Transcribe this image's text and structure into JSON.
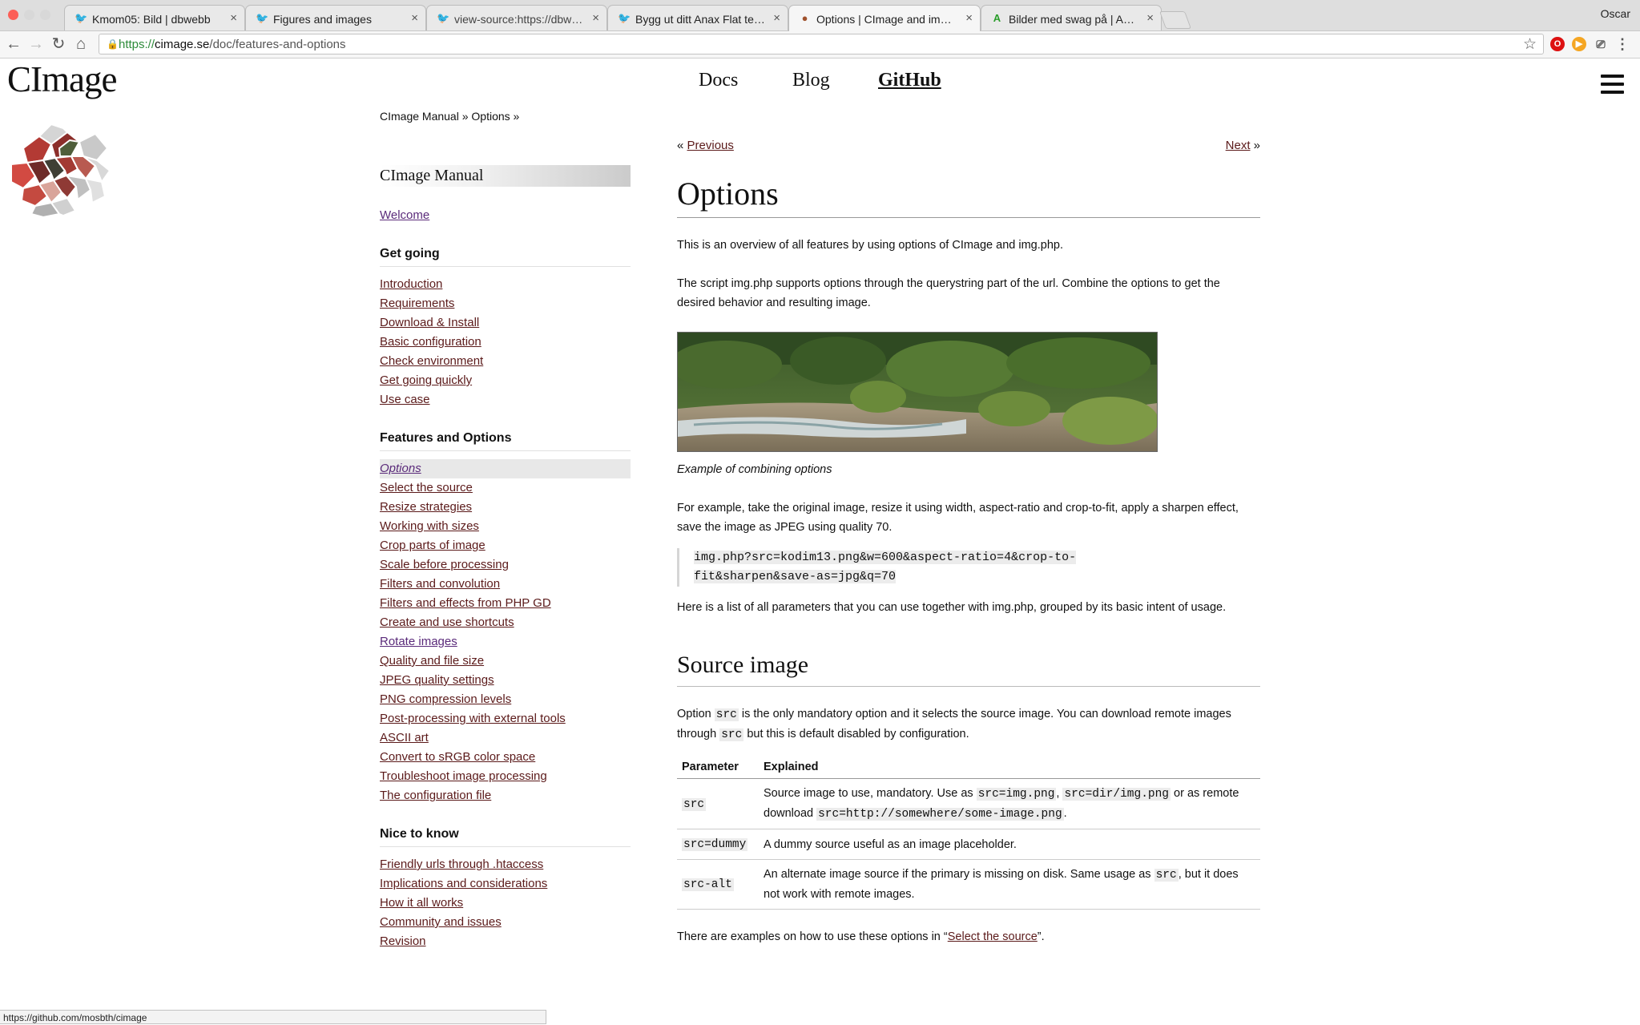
{
  "browser": {
    "tabs": [
      {
        "title": "Kmom05: Bild | dbwebb",
        "active": false
      },
      {
        "title": "Figures and images",
        "active": false
      },
      {
        "title": "view-source:https://dbwebb.se",
        "active": false
      },
      {
        "title": "Bygg ut ditt Anax Flat tema me",
        "active": false
      },
      {
        "title": "Options | CImage and img.php",
        "active": true
      },
      {
        "title": "Bilder med swag på | Anax Flat",
        "active": false
      }
    ],
    "profile_name": "Oscar",
    "url_protocol": "https://",
    "url_host": "cimage.se",
    "url_path": "/doc/features-and-options",
    "status_url": "https://github.com/mosbth/cimage"
  },
  "site": {
    "logo": "CImage",
    "nav": [
      "Docs",
      "Blog",
      "GitHub"
    ]
  },
  "breadcrumb": "CImage Manual » Options »",
  "sidebar": {
    "title": "CImage Manual",
    "welcome": "Welcome",
    "sections": [
      {
        "heading": "Get going",
        "links": [
          "Introduction",
          "Requirements",
          "Download & Install",
          "Basic configuration",
          "Check environment",
          "Get going quickly",
          "Use case"
        ]
      },
      {
        "heading": "Features and Options",
        "links": [
          "Options",
          "Select the source",
          "Resize strategies",
          "Working with sizes",
          "Crop parts of image",
          "Scale before processing",
          "Filters and convolution",
          "Filters and effects from PHP GD",
          "Create and use shortcuts",
          "Rotate images",
          "Quality and file size",
          "JPEG quality settings",
          "PNG compression levels",
          "Post-processing with external tools",
          "ASCII art",
          "Convert to sRGB color space",
          "Troubleshoot image processing",
          "The configuration file"
        ]
      },
      {
        "heading": "Nice to know",
        "links": [
          "Friendly urls through .htaccess",
          "Implications and considerations",
          "How it all works",
          "Community and issues",
          "Revision"
        ]
      }
    ]
  },
  "article": {
    "prev": "Previous",
    "next": "Next",
    "title": "Options",
    "intro": "This is an overview of all features by using options of CImage and img.php.",
    "para2": "The script img.php supports options through the querystring part of the url. Combine the options to get the desired behavior and resulting image.",
    "caption": "Example of combining options",
    "para3": "For example, take the original image, resize it using width, aspect-ratio and crop-to-fit, apply a sharpen effect, save the image as JPEG using quality 70.",
    "code_line1": "img.php?src=kodim13.png&w=600&aspect-ratio=4&crop-to-",
    "code_line2": "fit&sharpen&save-as=jpg&q=70",
    "para4": "Here is a list of all parameters that you can use together with img.php, grouped by its basic intent of usage.",
    "section_title": "Source image",
    "src_p_1": "Option ",
    "src_p_code1": "src",
    "src_p_2": " is the only mandatory option and it selects the source image. You can download remote images through ",
    "src_p_code2": "src",
    "src_p_3": " but this is default disabled by configuration.",
    "table_headers": [
      "Parameter",
      "Explained"
    ],
    "row1_param": "src",
    "row1_t1": "Source image to use, mandatory. Use as ",
    "row1_c1": "src=img.png",
    "row1_t2": ", ",
    "row1_c2": "src=dir/img.png",
    "row1_t3": " or as remote download ",
    "row1_c3": "src=http://somewhere/some-image.png",
    "row1_t4": ".",
    "row2_param": "src=dummy",
    "row2_text": "A dummy source useful as an image placeholder.",
    "row3_param": "src-alt",
    "row3_t1": "An alternate image source if the primary is missing on disk. Same usage as ",
    "row3_c1": "src",
    "row3_t2": ", but it does not work with remote images.",
    "examples_1": "There are examples on how to use these options in “",
    "examples_link": "Select the source",
    "examples_2": "”."
  }
}
